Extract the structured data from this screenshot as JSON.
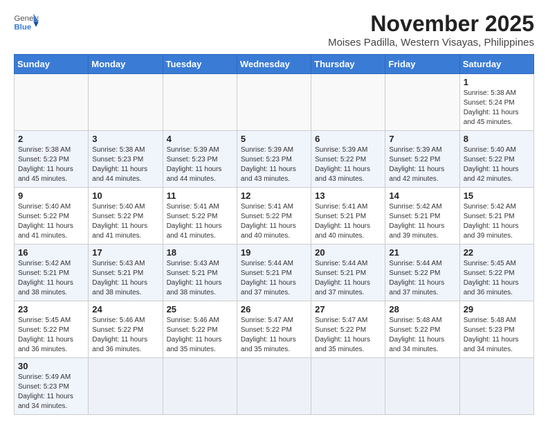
{
  "header": {
    "logo_general": "General",
    "logo_blue": "Blue",
    "month_title": "November 2025",
    "subtitle": "Moises Padilla, Western Visayas, Philippines"
  },
  "days_of_week": [
    "Sunday",
    "Monday",
    "Tuesday",
    "Wednesday",
    "Thursday",
    "Friday",
    "Saturday"
  ],
  "weeks": [
    [
      {
        "day": "",
        "info": ""
      },
      {
        "day": "",
        "info": ""
      },
      {
        "day": "",
        "info": ""
      },
      {
        "day": "",
        "info": ""
      },
      {
        "day": "",
        "info": ""
      },
      {
        "day": "",
        "info": ""
      },
      {
        "day": "1",
        "info": "Sunrise: 5:38 AM\nSunset: 5:24 PM\nDaylight: 11 hours\nand 45 minutes."
      }
    ],
    [
      {
        "day": "2",
        "info": "Sunrise: 5:38 AM\nSunset: 5:23 PM\nDaylight: 11 hours\nand 45 minutes."
      },
      {
        "day": "3",
        "info": "Sunrise: 5:38 AM\nSunset: 5:23 PM\nDaylight: 11 hours\nand 44 minutes."
      },
      {
        "day": "4",
        "info": "Sunrise: 5:39 AM\nSunset: 5:23 PM\nDaylight: 11 hours\nand 44 minutes."
      },
      {
        "day": "5",
        "info": "Sunrise: 5:39 AM\nSunset: 5:23 PM\nDaylight: 11 hours\nand 43 minutes."
      },
      {
        "day": "6",
        "info": "Sunrise: 5:39 AM\nSunset: 5:22 PM\nDaylight: 11 hours\nand 43 minutes."
      },
      {
        "day": "7",
        "info": "Sunrise: 5:39 AM\nSunset: 5:22 PM\nDaylight: 11 hours\nand 42 minutes."
      },
      {
        "day": "8",
        "info": "Sunrise: 5:40 AM\nSunset: 5:22 PM\nDaylight: 11 hours\nand 42 minutes."
      }
    ],
    [
      {
        "day": "9",
        "info": "Sunrise: 5:40 AM\nSunset: 5:22 PM\nDaylight: 11 hours\nand 41 minutes."
      },
      {
        "day": "10",
        "info": "Sunrise: 5:40 AM\nSunset: 5:22 PM\nDaylight: 11 hours\nand 41 minutes."
      },
      {
        "day": "11",
        "info": "Sunrise: 5:41 AM\nSunset: 5:22 PM\nDaylight: 11 hours\nand 41 minutes."
      },
      {
        "day": "12",
        "info": "Sunrise: 5:41 AM\nSunset: 5:22 PM\nDaylight: 11 hours\nand 40 minutes."
      },
      {
        "day": "13",
        "info": "Sunrise: 5:41 AM\nSunset: 5:21 PM\nDaylight: 11 hours\nand 40 minutes."
      },
      {
        "day": "14",
        "info": "Sunrise: 5:42 AM\nSunset: 5:21 PM\nDaylight: 11 hours\nand 39 minutes."
      },
      {
        "day": "15",
        "info": "Sunrise: 5:42 AM\nSunset: 5:21 PM\nDaylight: 11 hours\nand 39 minutes."
      }
    ],
    [
      {
        "day": "16",
        "info": "Sunrise: 5:42 AM\nSunset: 5:21 PM\nDaylight: 11 hours\nand 38 minutes."
      },
      {
        "day": "17",
        "info": "Sunrise: 5:43 AM\nSunset: 5:21 PM\nDaylight: 11 hours\nand 38 minutes."
      },
      {
        "day": "18",
        "info": "Sunrise: 5:43 AM\nSunset: 5:21 PM\nDaylight: 11 hours\nand 38 minutes."
      },
      {
        "day": "19",
        "info": "Sunrise: 5:44 AM\nSunset: 5:21 PM\nDaylight: 11 hours\nand 37 minutes."
      },
      {
        "day": "20",
        "info": "Sunrise: 5:44 AM\nSunset: 5:21 PM\nDaylight: 11 hours\nand 37 minutes."
      },
      {
        "day": "21",
        "info": "Sunrise: 5:44 AM\nSunset: 5:22 PM\nDaylight: 11 hours\nand 37 minutes."
      },
      {
        "day": "22",
        "info": "Sunrise: 5:45 AM\nSunset: 5:22 PM\nDaylight: 11 hours\nand 36 minutes."
      }
    ],
    [
      {
        "day": "23",
        "info": "Sunrise: 5:45 AM\nSunset: 5:22 PM\nDaylight: 11 hours\nand 36 minutes."
      },
      {
        "day": "24",
        "info": "Sunrise: 5:46 AM\nSunset: 5:22 PM\nDaylight: 11 hours\nand 36 minutes."
      },
      {
        "day": "25",
        "info": "Sunrise: 5:46 AM\nSunset: 5:22 PM\nDaylight: 11 hours\nand 35 minutes."
      },
      {
        "day": "26",
        "info": "Sunrise: 5:47 AM\nSunset: 5:22 PM\nDaylight: 11 hours\nand 35 minutes."
      },
      {
        "day": "27",
        "info": "Sunrise: 5:47 AM\nSunset: 5:22 PM\nDaylight: 11 hours\nand 35 minutes."
      },
      {
        "day": "28",
        "info": "Sunrise: 5:48 AM\nSunset: 5:22 PM\nDaylight: 11 hours\nand 34 minutes."
      },
      {
        "day": "29",
        "info": "Sunrise: 5:48 AM\nSunset: 5:23 PM\nDaylight: 11 hours\nand 34 minutes."
      }
    ],
    [
      {
        "day": "30",
        "info": "Sunrise: 5:49 AM\nSunset: 5:23 PM\nDaylight: 11 hours\nand 34 minutes."
      },
      {
        "day": "",
        "info": ""
      },
      {
        "day": "",
        "info": ""
      },
      {
        "day": "",
        "info": ""
      },
      {
        "day": "",
        "info": ""
      },
      {
        "day": "",
        "info": ""
      },
      {
        "day": "",
        "info": ""
      }
    ]
  ]
}
